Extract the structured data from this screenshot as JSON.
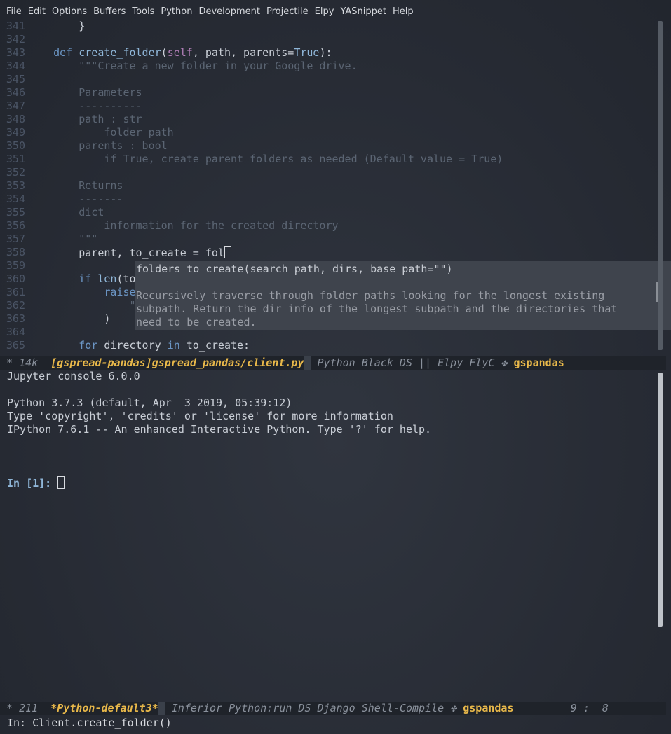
{
  "menu": [
    "File",
    "Edit",
    "Options",
    "Buffers",
    "Tools",
    "Python",
    "Development",
    "Projectile",
    "Elpy",
    "YASnippet",
    "Help"
  ],
  "editor": {
    "lines": [
      {
        "n": "341",
        "html": "        }"
      },
      {
        "n": "342",
        "html": ""
      },
      {
        "n": "343",
        "html": "    <span class='kw'>def</span> <span class='fn'>create_folder</span>(<span class='self'>self</span>, path, parents=<span class='true'>True</span>):"
      },
      {
        "n": "344",
        "html": "        <span class='doc'>\"\"\"Create a new folder in your Google drive.</span>"
      },
      {
        "n": "345",
        "html": ""
      },
      {
        "n": "346",
        "html": "        <span class='doc'>Parameters</span>"
      },
      {
        "n": "347",
        "html": "        <span class='doc'>----------</span>"
      },
      {
        "n": "348",
        "html": "        <span class='doc'>path : str</span>"
      },
      {
        "n": "349",
        "html": "            <span class='doc'>folder path</span>"
      },
      {
        "n": "350",
        "html": "        <span class='doc'>parents : bool</span>"
      },
      {
        "n": "351",
        "html": "            <span class='doc'>if True, create parent folders as needed (Default value = True)</span>"
      },
      {
        "n": "352",
        "html": ""
      },
      {
        "n": "353",
        "html": "        <span class='doc'>Returns</span>"
      },
      {
        "n": "354",
        "html": "        <span class='doc'>-------</span>"
      },
      {
        "n": "355",
        "html": "        <span class='doc'>dict</span>"
      },
      {
        "n": "356",
        "html": "            <span class='doc'>information for the created directory</span>"
      },
      {
        "n": "357",
        "html": "        <span class='doc'>\"\"\"</span>"
      },
      {
        "n": "358",
        "html": "        parent, to_create = fol<span class='cursor'></span>"
      },
      {
        "n": "359",
        "html": ""
      },
      {
        "n": "360",
        "html": "        <span class='kw'>if</span> <span class='fn'>len</span>(to_create) &gt; 1 <span class='kw'>and</span> parents <span class='kw'>is not</span> <span class='true'>True</span>:"
      },
      {
        "n": "361",
        "html": "            <span class='kw'>raise</span> <span class='fn'>Exception</span>("
      },
      {
        "n": "362",
        "html": "                <span class='doc'>\"If you want to create nested directories pass parents=True\"</span>"
      },
      {
        "n": "363",
        "html": "            )"
      },
      {
        "n": "364",
        "html": ""
      },
      {
        "n": "365",
        "html": "        <span class='kw'>for</span> directory <span class='kw'>in</span> to_create:"
      }
    ]
  },
  "popup": {
    "signature": "folders_to_create(search_path, dirs, base_path=\"\")",
    "doc_line1": "Recursively traverse through folder paths looking for the longest existing",
    "doc_line2": "subpath. Return the dir info of the longest subpath and the directories that",
    "doc_line3": "need to be created."
  },
  "modeline1": {
    "state": " * 14k ",
    "buffer": " [gspread-pandas]gspread_pandas/client.py",
    "modes": " Python Black DS || Elpy FlyC ",
    "project_icon": "✤",
    "project": "gspandas"
  },
  "console": {
    "banner1": "Jupyter console 6.0.0",
    "banner2": "Python 3.7.3 (default, Apr  3 2019, 05:39:12)",
    "banner3": "Type 'copyright', 'credits' or 'license' for more information",
    "banner4": "IPython 7.6.1 -- An enhanced Interactive Python. Type '?' for help.",
    "prompt": "In [1]: "
  },
  "modeline2": {
    "state": " * 211 ",
    "buffer": " *Python-default3*",
    "modes": " Inferior Python:run DS Django Shell-Compile ",
    "project_icon": "✤",
    "project": "gspandas",
    "position": "         9 :  8"
  },
  "echo": "In: Client.create_folder()"
}
